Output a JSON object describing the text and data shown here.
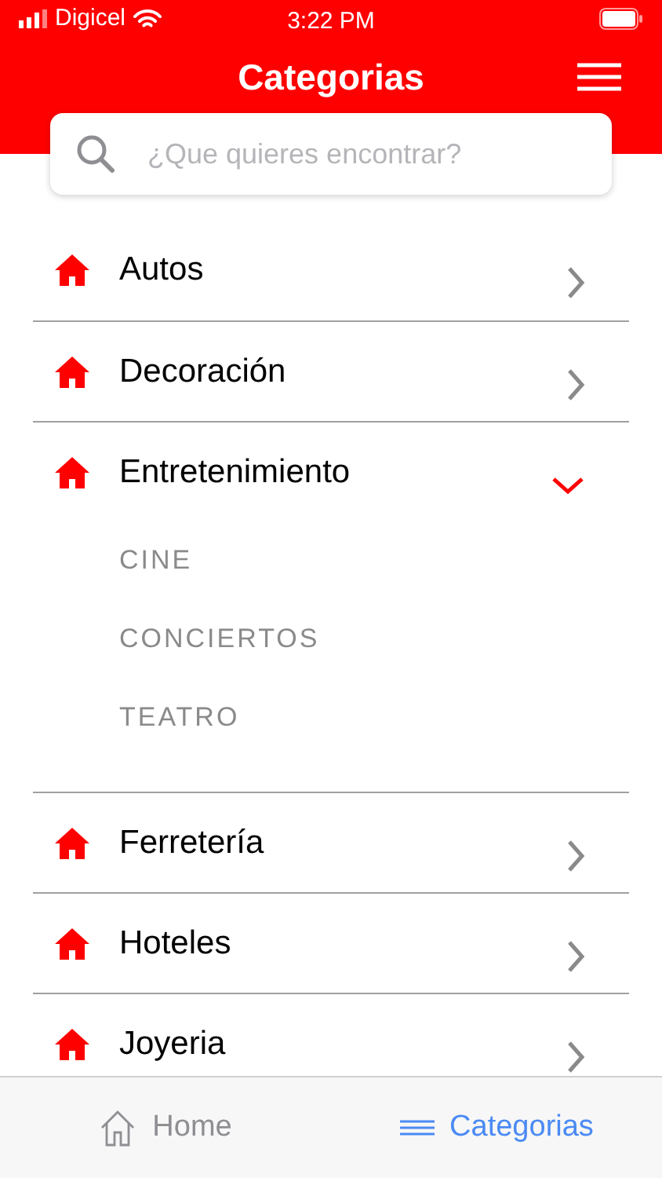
{
  "status_bar": {
    "carrier": "Digicel",
    "time": "3:22 PM"
  },
  "header": {
    "title": "Categorias"
  },
  "search": {
    "placeholder": "¿Que quieres encontrar?"
  },
  "categories": [
    {
      "label": "Autos",
      "expanded": false
    },
    {
      "label": "Decoración",
      "expanded": false
    },
    {
      "label": "Entretenimiento",
      "expanded": true,
      "children": [
        {
          "label": "CINE"
        },
        {
          "label": "CONCIERTOS"
        },
        {
          "label": "TEATRO"
        }
      ]
    },
    {
      "label": "Ferretería",
      "expanded": false
    },
    {
      "label": "Hoteles",
      "expanded": false
    },
    {
      "label": "Joyeria",
      "expanded": false
    }
  ],
  "tab_bar": [
    {
      "label": "Home",
      "kind": "home",
      "selected": false
    },
    {
      "label": "Categorias",
      "kind": "list",
      "selected": true
    }
  ]
}
